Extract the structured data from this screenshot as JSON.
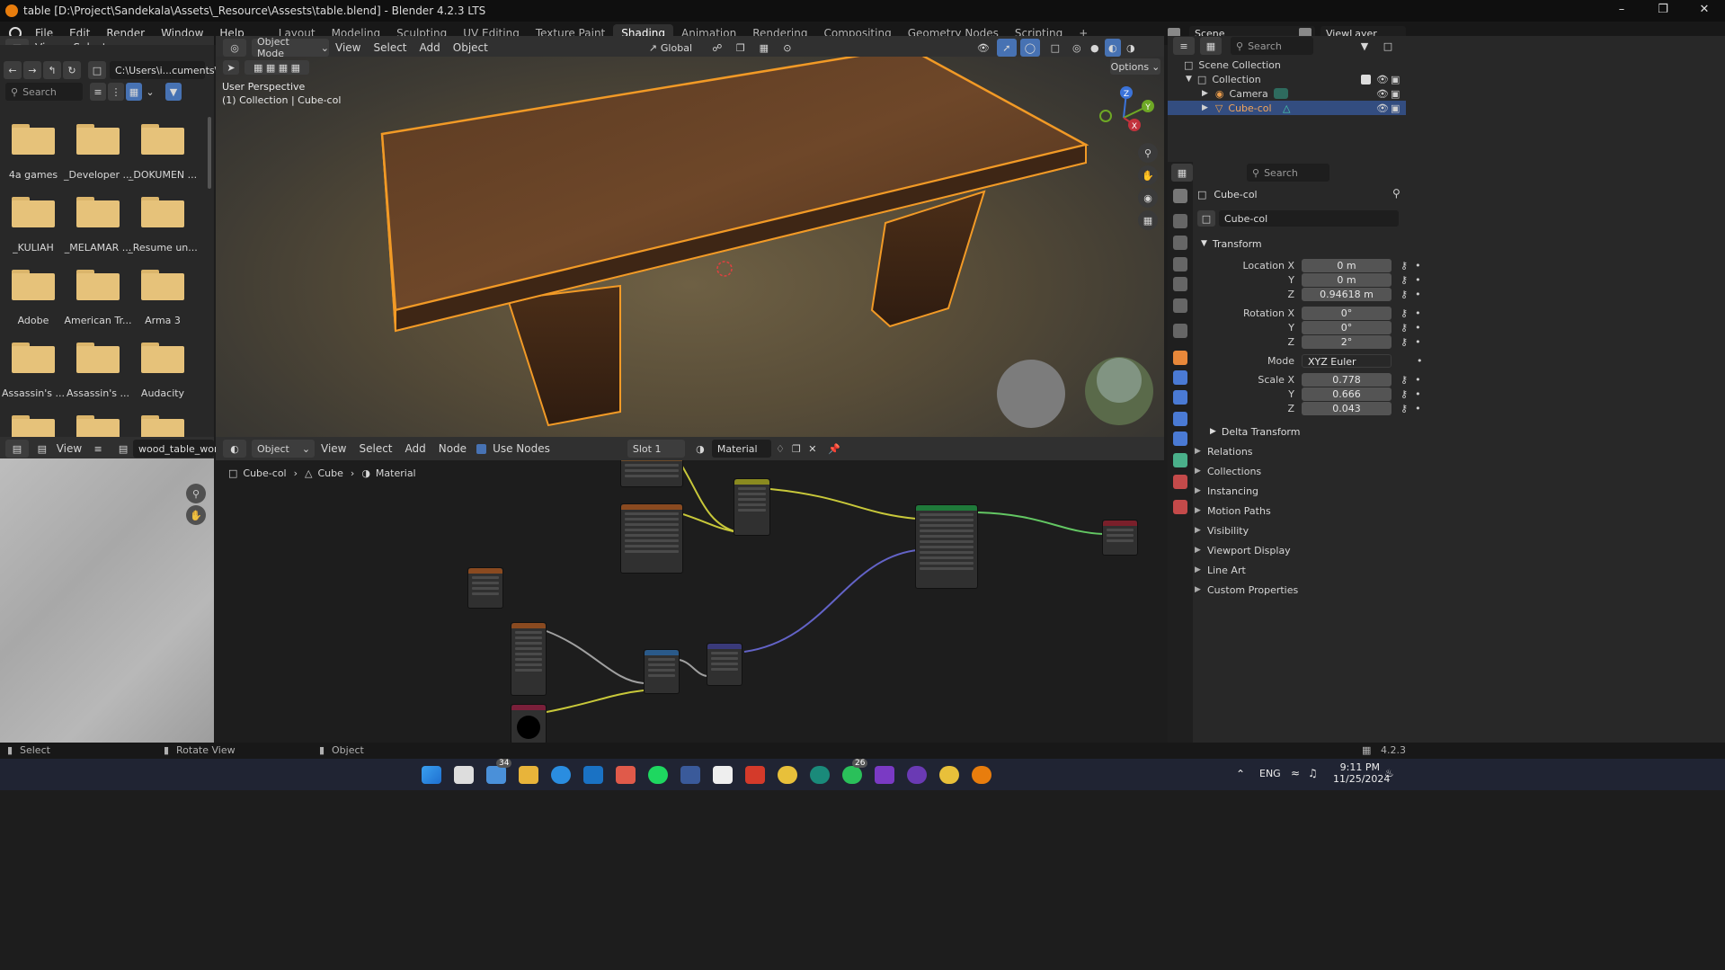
{
  "window": {
    "title": "table [D:\\Project\\Sandekala\\Assets\\_Resource\\Assests\\table.blend] - Blender 4.2.3 LTS"
  },
  "menu": [
    "File",
    "Edit",
    "Render",
    "Window",
    "Help"
  ],
  "workspaces": [
    "Layout",
    "Modeling",
    "Sculpting",
    "UV Editing",
    "Texture Paint",
    "Shading",
    "Animation",
    "Rendering",
    "Compositing",
    "Geometry Nodes",
    "Scripting"
  ],
  "active_workspace": "Shading",
  "scene": {
    "label": "Scene",
    "viewlayer": "ViewLayer"
  },
  "filebrowser": {
    "menu": [
      "View",
      "Select"
    ],
    "path": "C:\\Users\\i...cuments\\",
    "search_placeholder": "Search",
    "folders": [
      "4a games",
      "_Developer ...",
      "_DOKUMEN ...",
      "_KULIAH",
      "_MELAMAR ...",
      "_Resume un...",
      "Adobe",
      "American Tr...",
      "Arma 3",
      "Assassin's ...",
      "Assassin's ...",
      "Audacity"
    ]
  },
  "viewport": {
    "mode": "Object Mode",
    "menu": [
      "View",
      "Select",
      "Add",
      "Object"
    ],
    "transform": "Global",
    "options": "Options",
    "overlay_line1": "User Perspective",
    "overlay_line2": "(1) Collection | Cube-col",
    "gizmo": {
      "x": "X",
      "y": "Y",
      "z": "Z"
    }
  },
  "image_editor": {
    "menu": "View",
    "image_name": "wood_table_worn_"
  },
  "node_editor": {
    "type": "Object",
    "menu": [
      "View",
      "Select",
      "Add",
      "Node"
    ],
    "use_nodes": "Use Nodes",
    "slot": "Slot 1",
    "material": "Material",
    "breadcrumb": [
      "Cube-col",
      "Cube",
      "Material"
    ]
  },
  "outliner": {
    "search_placeholder": "Search",
    "root": "Scene Collection",
    "collection": "Collection",
    "items": [
      "Camera",
      "Cube-col"
    ]
  },
  "properties": {
    "search_placeholder": "Search",
    "object_name": "Cube-col",
    "data_name": "Cube-col",
    "transform_title": "Transform",
    "location": {
      "x": "0 m",
      "y": "0 m",
      "z": "0.94618 m"
    },
    "rotation": {
      "x": "0°",
      "y": "0°",
      "z": "2°"
    },
    "mode": "XYZ Euler",
    "scale": {
      "x": "0.778",
      "y": "0.666",
      "z": "0.043"
    },
    "labels": {
      "location_x": "Location X",
      "rotation_x": "Rotation X",
      "scale_x": "Scale X",
      "y": "Y",
      "z": "Z",
      "mode": "Mode"
    },
    "delta": "Delta Transform",
    "sections": [
      "Relations",
      "Collections",
      "Instancing",
      "Motion Paths",
      "Visibility",
      "Viewport Display",
      "Line Art",
      "Custom Properties"
    ]
  },
  "statusbar": {
    "select": "Select",
    "rotate": "Rotate View",
    "object": "Object",
    "version": "4.2.3"
  },
  "taskbar": {
    "lang": "ENG",
    "time": "9:11 PM",
    "date": "11/25/2024",
    "badge1": "34",
    "badge2": "26"
  },
  "colors": {
    "accent": "#e87d0d",
    "selection": "#334d80",
    "workspace_active": "#303030"
  }
}
